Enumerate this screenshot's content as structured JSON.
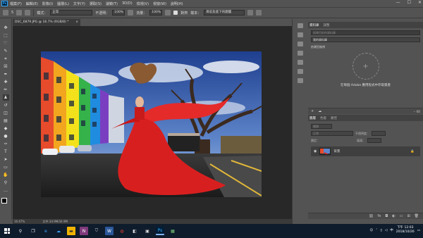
{
  "menubar": {
    "logo": "Ps",
    "items": [
      "檔案(F)",
      "編輯(E)",
      "影像(I)",
      "圖層(L)",
      "文字(Y)",
      "選取(S)",
      "濾鏡(T)",
      "3D(D)",
      "檢視(V)",
      "視窗(W)",
      "說明(H)"
    ],
    "window_controls": [
      "—",
      "☐",
      "✕"
    ]
  },
  "options": {
    "brush_size": "5",
    "mode_label": "模式：",
    "mode_value": "正常",
    "opacity_label": "不透明：",
    "opacity_value": "100%",
    "flow_label": "流量：",
    "flow_value": "100%",
    "aligned_label": "對齊",
    "sample_label": "樣本：",
    "sample_value": "目前及底下的圖層"
  },
  "document": {
    "tab_title": "DSC_6879.JPG @ 16.7% (RGB/8) *",
    "close": "×"
  },
  "statusbar": {
    "zoom": "16.67%",
    "doc_size": "文件:34.9M/34.9M"
  },
  "libraries": {
    "tabs": [
      "資料庫",
      "調整"
    ],
    "search_placeholder": "搜尋目前的資料庫",
    "library_name": "我的資料庫",
    "view_label": "依類型檢視",
    "plus": "+",
    "message": "在每個 Adobe 應用程式中存取資產",
    "kb": "-- KB"
  },
  "layers": {
    "tabs": [
      "圖層",
      "色版",
      "路徑"
    ],
    "kind_label": "種類",
    "mode_value": "正常",
    "opacity_label": "不透明度：",
    "lock_label": "鎖定：",
    "fill_label": "填滿：",
    "layer_name": "背景"
  },
  "taskbar": {
    "time": "下午 12:03",
    "date": "2018/10/26",
    "lang": "中"
  },
  "colors": {
    "ui_bg": "#535353",
    "canvas_bg": "#282828",
    "taskbar_bg": "#0f1c2c"
  }
}
